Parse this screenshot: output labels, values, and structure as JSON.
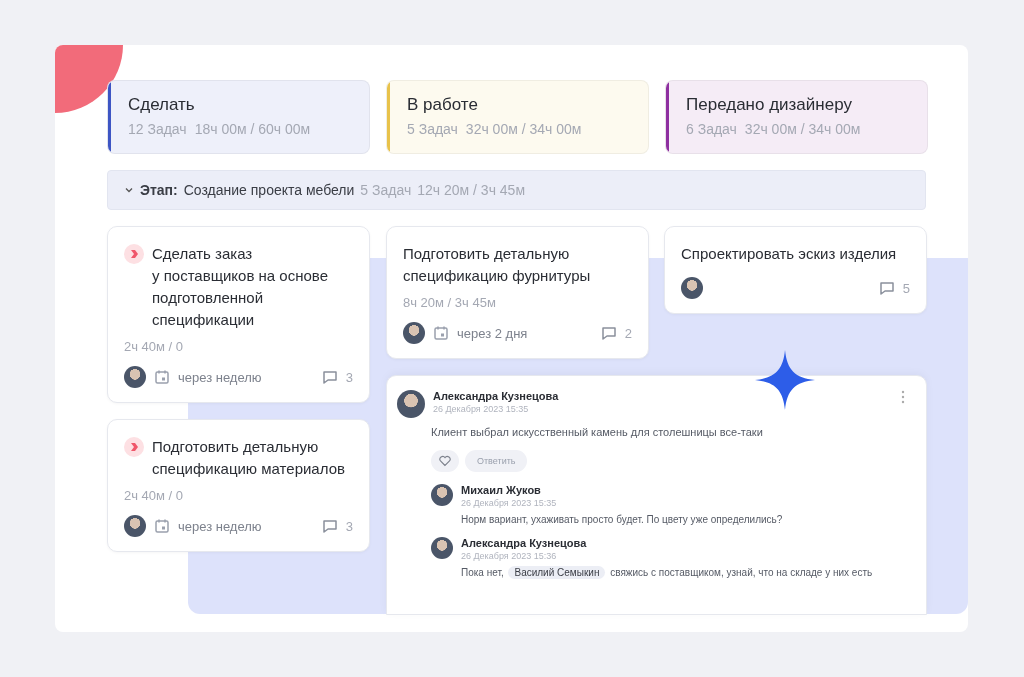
{
  "columns": [
    {
      "title": "Сделать",
      "count": "12 Задач",
      "time": "18ч 00м / 60ч 00м",
      "color": "#3d55c4"
    },
    {
      "title": "В работе",
      "count": "5 Задач",
      "time": "32ч 00м / 34ч 00м",
      "color": "#e8c24a"
    },
    {
      "title": "Передано дизайнеру",
      "count": "6 Задач",
      "time": "32ч 00м / 34ч 00м",
      "color": "#8e2fa0"
    }
  ],
  "stage": {
    "expanded": true,
    "label": "Этап:",
    "name": "Создание проекта мебели",
    "count": "5 Задач",
    "time": "12ч 20м / 3ч 45м"
  },
  "cards": [
    [
      {
        "title": "Сделать заказ\nу поставщиков на основе подготовленной спецификации",
        "priority": true,
        "time": "2ч 40м / 0",
        "due": "через неделю",
        "comments": "3"
      },
      {
        "title": "Подготовить детальную спецификацию материалов",
        "priority": true,
        "time": "2ч 40м / 0",
        "due": "через неделю",
        "comments": "3"
      }
    ],
    [
      {
        "title": "Подготовить детальную спецификацию фурнитуры",
        "priority": false,
        "time": "8ч 20м / 3ч 45м",
        "due": "через 2 дня",
        "comments": "2"
      }
    ],
    [
      {
        "title": "Спроектировать эскиз изделия",
        "priority": false,
        "comments": "5"
      }
    ]
  ],
  "thread": {
    "author": "Александра Кузнецова",
    "date": "26 Декабря 2023 15:35",
    "text": "Клиент выбрал искусственный камень для столешницы все-таки",
    "liked": false,
    "reply_label": "Ответить",
    "replies": [
      {
        "author": "Михаил Жуков",
        "date": "26 Декабря 2023 15:35",
        "parts": [
          {
            "kind": "text",
            "text": "Норм вариант, ухаживать просто будет. По цвету уже определились?"
          }
        ]
      },
      {
        "author": "Александра Кузнецова",
        "date": "26 Декабря 2023 15:36",
        "parts": [
          {
            "kind": "text",
            "text": "Пока нет,"
          },
          {
            "kind": "mention",
            "text": "Василий Семыкин"
          },
          {
            "kind": "text",
            "text": "свяжись с поставщиком, узнай, что на складе у них есть"
          }
        ]
      }
    ]
  }
}
